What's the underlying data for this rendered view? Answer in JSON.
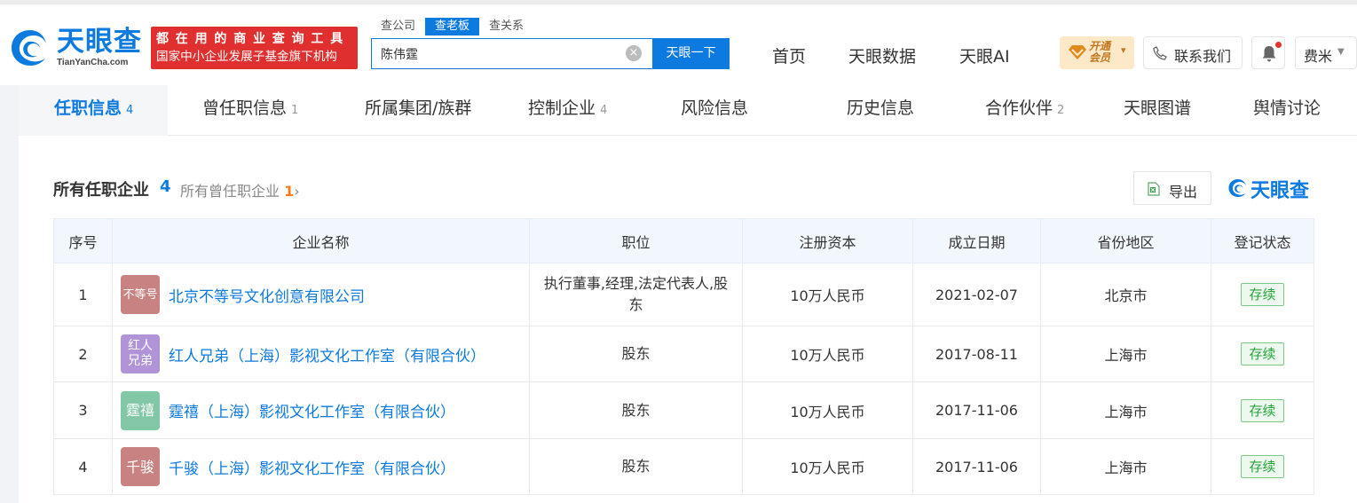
{
  "header": {
    "logo_cn": "天眼查",
    "logo_en": "TianYanCha.com",
    "slogan_line1": "都在用的商业查询工具",
    "slogan_line2": "国家中小企业发展子基金旗下机构",
    "search_tabs": [
      "查公司",
      "查老板",
      "查关系"
    ],
    "search_value": "陈伟霆",
    "search_button": "天眼一下",
    "nav": [
      "首页",
      "天眼数据",
      "天眼AI"
    ],
    "vip_line1": "开通",
    "vip_line2": "会员",
    "contact": "联系我们",
    "user": "费米"
  },
  "tabs": [
    {
      "label": "任职信息",
      "count": "4"
    },
    {
      "label": "曾任职信息",
      "count": "1"
    },
    {
      "label": "所属集团/族群",
      "count": ""
    },
    {
      "label": "控制企业",
      "count": "4"
    },
    {
      "label": "风险信息",
      "count": ""
    },
    {
      "label": "历史信息",
      "count": ""
    },
    {
      "label": "合作伙伴",
      "count": "2"
    },
    {
      "label": "天眼图谱",
      "count": ""
    },
    {
      "label": "舆情讨论",
      "count": ""
    }
  ],
  "section": {
    "title": "所有任职企业",
    "count": "4",
    "former_link": "所有曾任职企业",
    "former_count": "1",
    "export": "导出",
    "brand": "天眼查"
  },
  "table": {
    "headers": [
      "序号",
      "企业名称",
      "职位",
      "注册资本",
      "成立日期",
      "省份地区",
      "登记状态"
    ],
    "rows": [
      {
        "index": "1",
        "logo_text": "不等号",
        "logo_color": "#c98282",
        "name": "北京不等号文化创意有限公司",
        "position": "执行董事,经理,法定代表人,股东",
        "capital": "10万人民币",
        "date": "2021-02-07",
        "region": "北京市",
        "status": "存续"
      },
      {
        "index": "2",
        "logo_text": "红人兄弟",
        "logo_color": "#b193d8",
        "name": "红人兄弟（上海）影视文化工作室（有限合伙）",
        "position": "股东",
        "capital": "10万人民币",
        "date": "2017-08-11",
        "region": "上海市",
        "status": "存续"
      },
      {
        "index": "3",
        "logo_text": "霆禧",
        "logo_color": "#82c8a6",
        "name": "霆禧（上海）影视文化工作室（有限合伙）",
        "position": "股东",
        "capital": "10万人民币",
        "date": "2017-11-06",
        "region": "上海市",
        "status": "存续"
      },
      {
        "index": "4",
        "logo_text": "千骏",
        "logo_color": "#c98282",
        "name": "千骏（上海）影视文化工作室（有限合伙）",
        "position": "股东",
        "capital": "10万人民币",
        "date": "2017-11-06",
        "region": "上海市",
        "status": "存续"
      }
    ]
  },
  "colors": {
    "brand_blue": "#0d7ae0",
    "slogan_red": "#e02f2f",
    "status_green": "#25a33a",
    "count_orange": "#ff7a1a"
  }
}
